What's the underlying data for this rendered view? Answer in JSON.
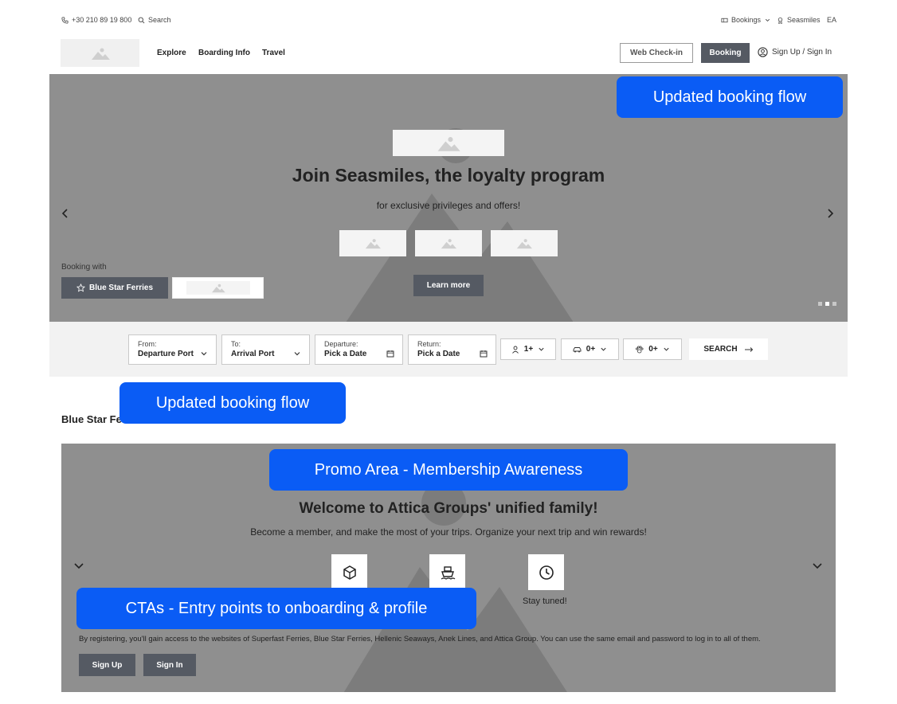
{
  "topbar": {
    "phone": "+30 210 89 19 800",
    "search": "Search",
    "bookings": "Bookings",
    "seasmiles": "Seasmiles",
    "language": "EA"
  },
  "nav": {
    "links": [
      "Explore",
      "Boarding Info",
      "Travel"
    ],
    "web_checkin": "Web Check-in",
    "booking": "Booking",
    "signin": "Sign Up / Sign In"
  },
  "hero": {
    "title": "Join Seasmiles, the loyalty program",
    "subtitle": "for exclusive privileges and offers!",
    "cta": "Learn more",
    "booking_with_label": "Booking with",
    "booking_with_button": "Blue Star Ferries",
    "slides": 3,
    "active_slide": 2
  },
  "search": {
    "from_label": "From:",
    "from_value": "Departure Port",
    "to_label": "To:",
    "to_value": "Arrival Port",
    "departure_label": "Departure:",
    "departure_value": "Pick a Date",
    "return_label": "Return:",
    "return_value": "Pick a Date",
    "passengers": "1+",
    "vehicles": "0+",
    "pets": "0+",
    "button": "SEARCH"
  },
  "annotations": {
    "booking_flow_1": "Updated booking flow",
    "booking_flow_2": "Updated booking flow",
    "promo_area": "Promo Area - Membership Awareness",
    "ctas": "CTAs - Entry points to onboarding & profile"
  },
  "section": {
    "title": "Blue Star Fe"
  },
  "promo": {
    "title": "Welcome to Attica Groups' unified family!",
    "subtitle": "Become a member, and make the most of your trips. Organize your next trip and win rewards!",
    "stay_tuned": "Stay tuned!",
    "note": "By registering, you'll gain access to the websites of Superfast Ferries, Blue Star Ferries, Hellenic Seaways, Anek Lines, and Attica Group. You can use the same email and password to log in to all of them.",
    "signup": "Sign Up",
    "signin": "Sign In"
  },
  "colors": {
    "annotation": "#0a5cf5",
    "dark_button": "#555a63",
    "hero_bg": "#8f8f8f"
  }
}
